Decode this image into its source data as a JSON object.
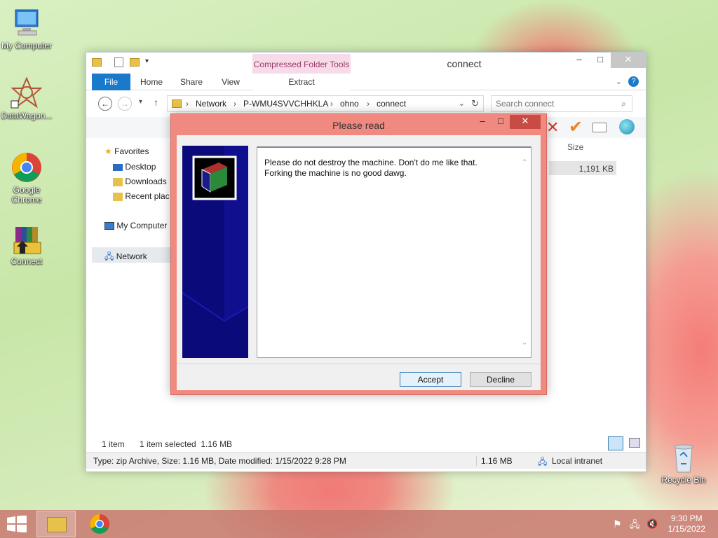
{
  "desktop": {
    "icons": [
      {
        "label": "My Computer"
      },
      {
        "label": "DataWagon..."
      },
      {
        "label": "Google Chrome"
      },
      {
        "label": "Connect"
      },
      {
        "label": "Recycle Bin"
      }
    ]
  },
  "explorer": {
    "title": "connect",
    "contextual_group": "Compressed Folder Tools",
    "tabs": {
      "file": "File",
      "home": "Home",
      "share": "Share",
      "view": "View",
      "extract": "Extract"
    },
    "breadcrumb": [
      "Network",
      "P-WMU4SVVCHHKLA",
      "ohno",
      "connect"
    ],
    "search_placeholder": "Search connect",
    "column_size": "Size",
    "file_size": "1,191 KB",
    "nav": {
      "favorites": "Favorites",
      "desktop": "Desktop",
      "downloads": "Downloads",
      "recent": "Recent plac",
      "my_computer": "My Computer",
      "network": "Network"
    },
    "status": {
      "items": "1 item",
      "selected": "1 item selected  1.16 MB"
    },
    "info": {
      "details": "Type: zip Archive, Size: 1.16 MB, Date modified: 1/15/2022 9:28 PM",
      "size": "1.16 MB",
      "zone": "Local intranet"
    }
  },
  "dialog": {
    "title": "Please read",
    "message_line1": "Please do not destroy the machine. Don't do me like that.",
    "message_line2": "Forking the machine is no good dawg.",
    "accept": "Accept",
    "decline": "Decline"
  },
  "taskbar": {
    "time": "9:30 PM",
    "date": "1/15/2022"
  },
  "colors": {
    "dialog_frame": "#f08a80",
    "file_tab": "#1979ca",
    "side_panel": "#0a0a7a"
  }
}
